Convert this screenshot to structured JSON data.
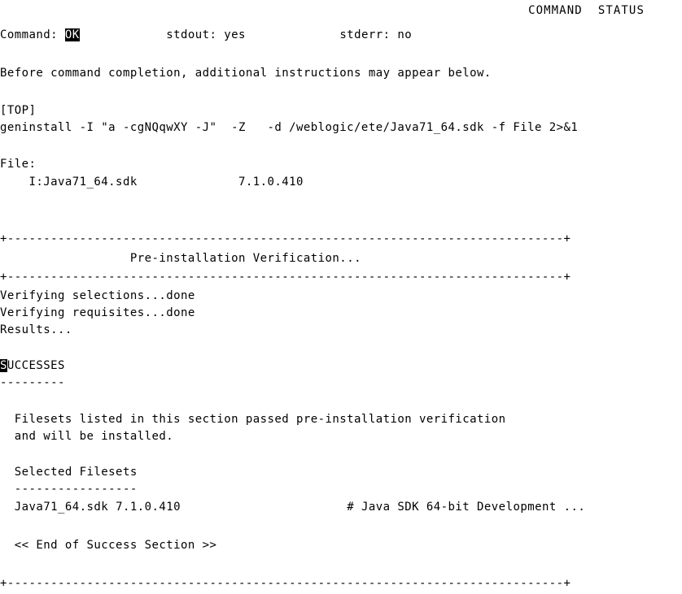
{
  "screen": {
    "title": "COMMAND  STATUS",
    "status_line": {
      "command_label": "Command:",
      "command_value": "OK",
      "stdout_label": "stdout:",
      "stdout_value": "yes",
      "stderr_label": "stderr:",
      "stderr_value": "no"
    },
    "instruction": "Before command completion, additional instructions may appear below.",
    "top_marker": "[TOP]",
    "command_line": "geninstall -I \"a -cgNQqwXY -J\"  -Z   -d /weblogic/ete/Java71_64.sdk -f File 2>&1",
    "file_section": {
      "label": "File:",
      "entry": "I:Java71_64.sdk",
      "version": "7.1.0.410"
    },
    "box_rule": "+-----------------------------------------------------------------------------+",
    "verification_title": "Pre-installation Verification...",
    "verify_lines": [
      "Verifying selections...done",
      "Verifying requisites...done",
      "Results..."
    ],
    "successes": {
      "heading_first_char": "S",
      "heading_rest": "UCCESSES",
      "underline": "---------",
      "body_lines": [
        "  Filesets listed in this section passed pre-installation verification",
        "  and will be installed."
      ],
      "selected_label": "  Selected Filesets",
      "selected_underline": "  -----------------",
      "fileset": {
        "name": "Java71_64.sdk",
        "version": "7.1.0.410",
        "comment": "# Java SDK 64-bit Development ..."
      },
      "end_marker": "  << End of Success Section >>"
    }
  },
  "colors": {
    "background": "#ffffff",
    "foreground": "#000000",
    "inverse_bg": "#000000",
    "inverse_fg": "#ffffff"
  }
}
